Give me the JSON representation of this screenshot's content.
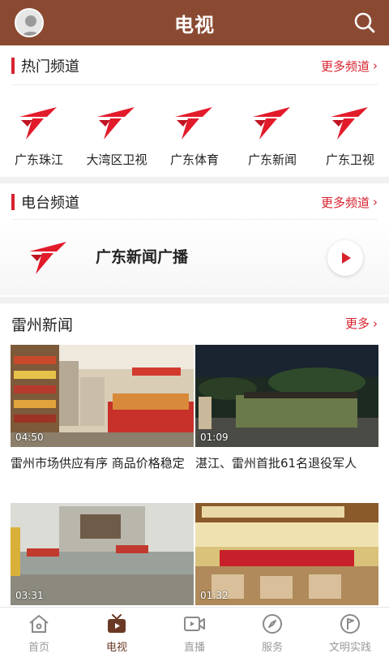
{
  "header": {
    "title": "电视"
  },
  "hot_channels": {
    "heading": "热门频道",
    "more": "更多频道",
    "items": [
      {
        "name": "广东珠江"
      },
      {
        "name": "大湾区卫视"
      },
      {
        "name": "广东体育"
      },
      {
        "name": "广东新闻"
      },
      {
        "name": "广东卫视"
      }
    ]
  },
  "radio_channels": {
    "heading": "电台频道",
    "more": "更多频道",
    "station": "广东新闻广播"
  },
  "news": {
    "heading": "雷州新闻",
    "more": "更多",
    "items": [
      {
        "duration": "04:50",
        "caption": "雷州市场供应有序 商品价格稳定"
      },
      {
        "duration": "01:09",
        "caption": "湛江、雷州首批61名退役军人"
      },
      {
        "duration": "03:31",
        "caption": ""
      },
      {
        "duration": "01:32",
        "caption": ""
      }
    ]
  },
  "bottom_nav": [
    {
      "label": "首页"
    },
    {
      "label": "电视"
    },
    {
      "label": "直播"
    },
    {
      "label": "服务"
    },
    {
      "label": "文明实践"
    }
  ],
  "colors": {
    "header": "#8a4a32",
    "accent": "#d7232f",
    "nav_active": "#6b3a26"
  },
  "icons": [
    "avatar",
    "search-icon",
    "channel-logo-icon",
    "play-icon",
    "home-icon",
    "tv-icon",
    "live-icon",
    "compass-icon",
    "flag-icon"
  ]
}
